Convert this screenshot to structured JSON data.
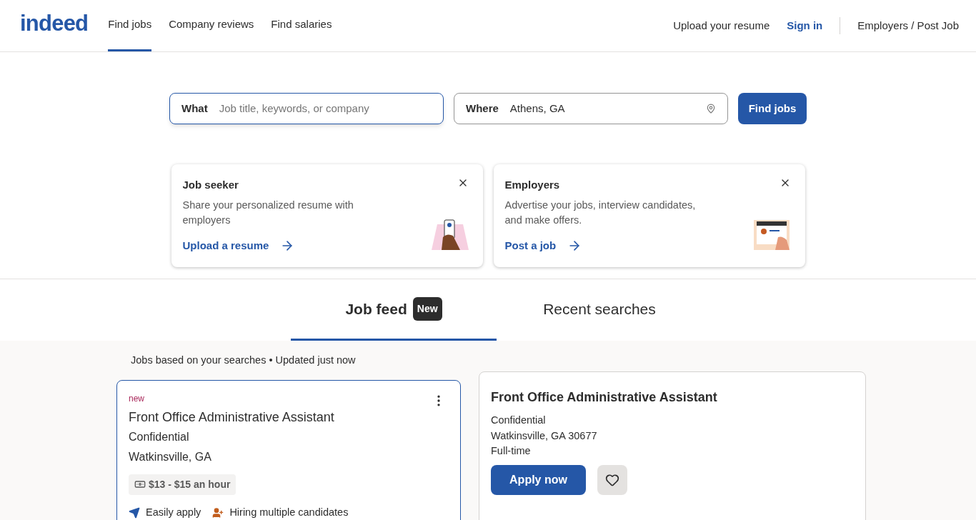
{
  "header": {
    "logo": "indeed",
    "nav": [
      {
        "label": "Find jobs",
        "selected": true
      },
      {
        "label": "Company reviews",
        "selected": false
      },
      {
        "label": "Find salaries",
        "selected": false
      }
    ],
    "upload": "Upload your resume",
    "sign_in": "Sign in",
    "employers": "Employers / Post Job"
  },
  "search": {
    "what_label": "What",
    "what_placeholder": "Job title, keywords, or company",
    "where_label": "Where",
    "where_value": "Athens, GA",
    "button": "Find jobs"
  },
  "promos": [
    {
      "title": "Job seeker",
      "text": "Share your personalized resume with employers",
      "link": "Upload a resume",
      "kind": "phone"
    },
    {
      "title": "Employers",
      "text": "Advertise your jobs, interview candidates, and make offers.",
      "link": "Post a job",
      "kind": "screen"
    }
  ],
  "feed_tabs": [
    {
      "label": "Job feed",
      "badge": "New",
      "selected": true
    },
    {
      "label": "Recent searches",
      "selected": false
    }
  ],
  "feed_note": "Jobs based on your searches • Updated just now",
  "job_card": {
    "tag": "new",
    "title": "Front Office Administrative Assistant",
    "company": "Confidential",
    "location": "Watkinsville, GA",
    "salary": "$13 - $15 an hour",
    "features": [
      "Easily apply",
      "Hiring multiple candidates"
    ],
    "selected": true
  },
  "detail": {
    "title": "Front Office Administrative Assistant",
    "company": "Confidential",
    "location": "Watkinsville, GA 30677",
    "type": "Full-time",
    "apply": "Apply now"
  }
}
